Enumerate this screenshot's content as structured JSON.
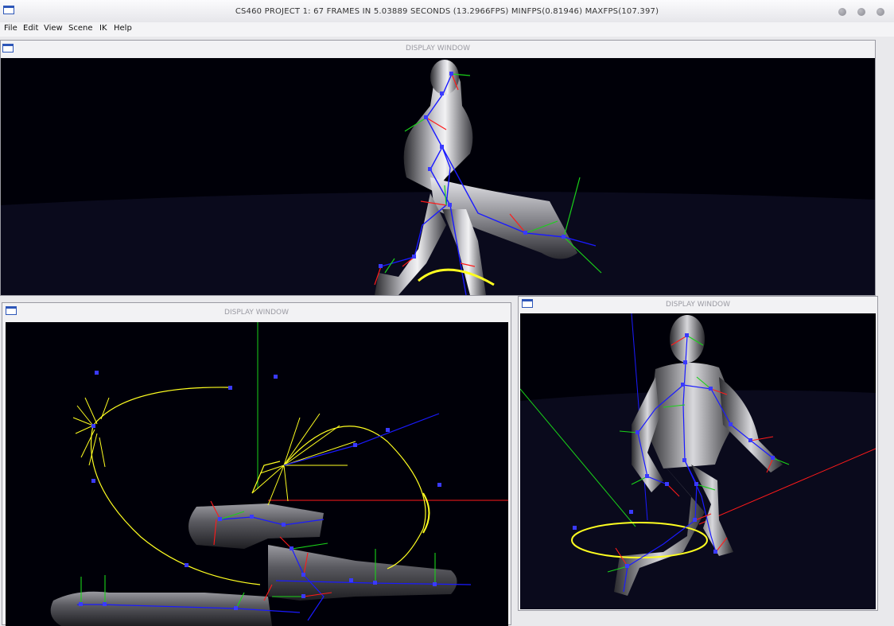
{
  "app": {
    "title": "CS460 PROJECT 1: 67 FRAMES IN 5.03889 SECONDS (13.2966FPS) MINFPS(0.81946) MAXFPS(107.397)"
  },
  "menu": {
    "items": [
      "File",
      "Edit",
      "View",
      "Scene",
      "IK",
      "Help"
    ]
  },
  "windows": {
    "top": {
      "title": "DISPLAY WINDOW"
    },
    "bottom_left": {
      "title": "DISPLAY WINDOW"
    },
    "bottom_right": {
      "title": "DISPLAY WINDOW"
    }
  },
  "colors": {
    "viewport_bg": "#000008",
    "ground": "#0a0a1c",
    "bone": "#1a1aff",
    "axis_x": "#ff1a1a",
    "axis_y": "#19d219",
    "trail": "#ffff20",
    "joint": "#3a3aff"
  }
}
